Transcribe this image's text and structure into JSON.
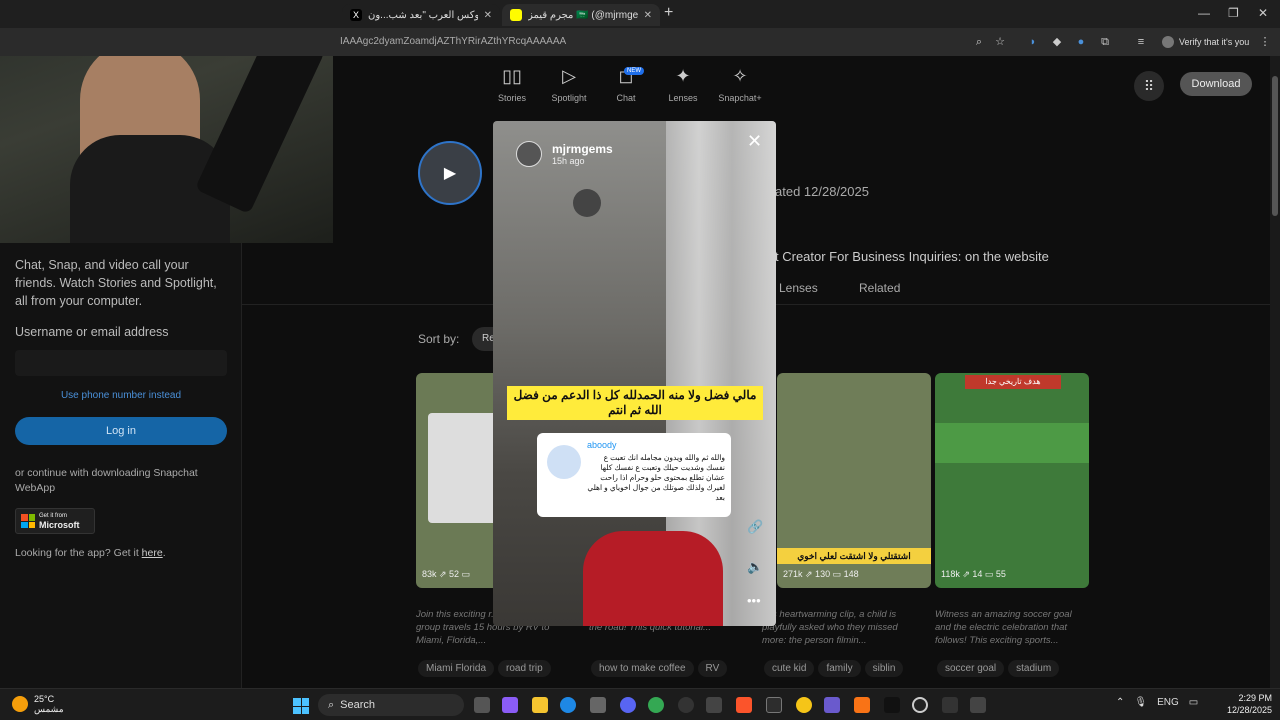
{
  "browser": {
    "tabs": [
      {
        "title": "اكس بوكس العرب \"بعد شب...ون X",
        "active": false
      },
      {
        "title": "مجرم قيمز 🇸🇦 (@mjrmgems...",
        "active": true
      }
    ],
    "url": "IAAAgc2dyamZoamdjAZThYRirAZthYRcqAAAAAA",
    "profile_label": "Verify that it's you"
  },
  "nav": {
    "items": [
      {
        "label": "Stories",
        "icon": "▯▯"
      },
      {
        "label": "Spotlight",
        "icon": "▷"
      },
      {
        "label": "Chat",
        "icon": "◻"
      },
      {
        "label": "Lenses",
        "icon": "✦"
      },
      {
        "label": "Snapchat+",
        "icon": "✧"
      }
    ],
    "chat_badge": "NEW",
    "download_label": "Download"
  },
  "sidebar": {
    "intro": "Chat, Snap, and video call your friends. Watch Stories and Spotlight, all from your computer.",
    "username_label": "Username or email address",
    "username_value": "",
    "phone_link": "Use phone number instead",
    "login_label": "Log in",
    "or_continue": "or continue with downloading Snapchat WebApp",
    "ms_badge_top": "Get it from",
    "ms_badge_name": "Microsoft",
    "looking_prefix": "Looking for the app? Get it ",
    "looking_link": "here",
    "looking_suffix": "."
  },
  "profile": {
    "updated": "ated 12/28/2025",
    "bio": "t Creator For Business Inquiries: on the website",
    "tabs": [
      "Lenses",
      "Related"
    ],
    "sort_label": "Sort by:",
    "sort_value": "Re"
  },
  "story": {
    "username": "mjrmgems",
    "time": "15h ago",
    "caption": "مالي فضل ولا منه الحمدلله كل ذا الدعم من فضل الله ثم انتم",
    "comment_user": "aboody",
    "comment_text": "والله ثم والله ويدون مجامله انك تعبت ع نفسك وشديت حيلك وتعبت ع نفسك كلها عشان تطلع بمحتوى حلو وحرام اذا راحت لغيرك ولذلك صوتلك من جوال اخوياي و اهلي بعد",
    "close_icon": "close-icon",
    "link_icon": "link-icon",
    "sound_icon": "speaker-icon",
    "more_icon": "more-icon"
  },
  "cards": [
    {
      "stats": "83k  ⇗ 52  ▭",
      "desc": "Join this exciting r... adventure as a group travels 15 hours by RV to Miami, Florida,...",
      "tags": [
        "Miami Florida",
        "road trip"
      ],
      "color": "#6b7a55"
    },
    {
      "stats": "",
      "desc": "cup of American coffee while on the road! This quick tutorial...",
      "tags": [
        "how to make coffee",
        "RV"
      ],
      "color": "#555"
    },
    {
      "stats": "271k  ⇗ 130  ▭ 148",
      "desc": "this heartwarming clip, a child is playfully asked who they missed more: the person filmin...",
      "tags": [
        "cute kid",
        "family",
        "siblin"
      ],
      "color": "#6f7d58",
      "overlay": "اشتقتلي ولا اشتقت لعلي اخوي"
    },
    {
      "stats": "118k  ⇗ 14  ▭ 55",
      "desc": "Witness an amazing soccer goal and the electric celebration that follows! This exciting sports...",
      "tags": [
        "soccer goal",
        "stadium"
      ],
      "color": "#3e7a3a",
      "overlay": "هدف تاريخي جدا"
    }
  ],
  "taskbar": {
    "temp": "25°C",
    "weather_text": "مشمس",
    "search_label": "Search",
    "lang": "ENG",
    "time": "2:29 PM",
    "date": "12/28/2025"
  }
}
